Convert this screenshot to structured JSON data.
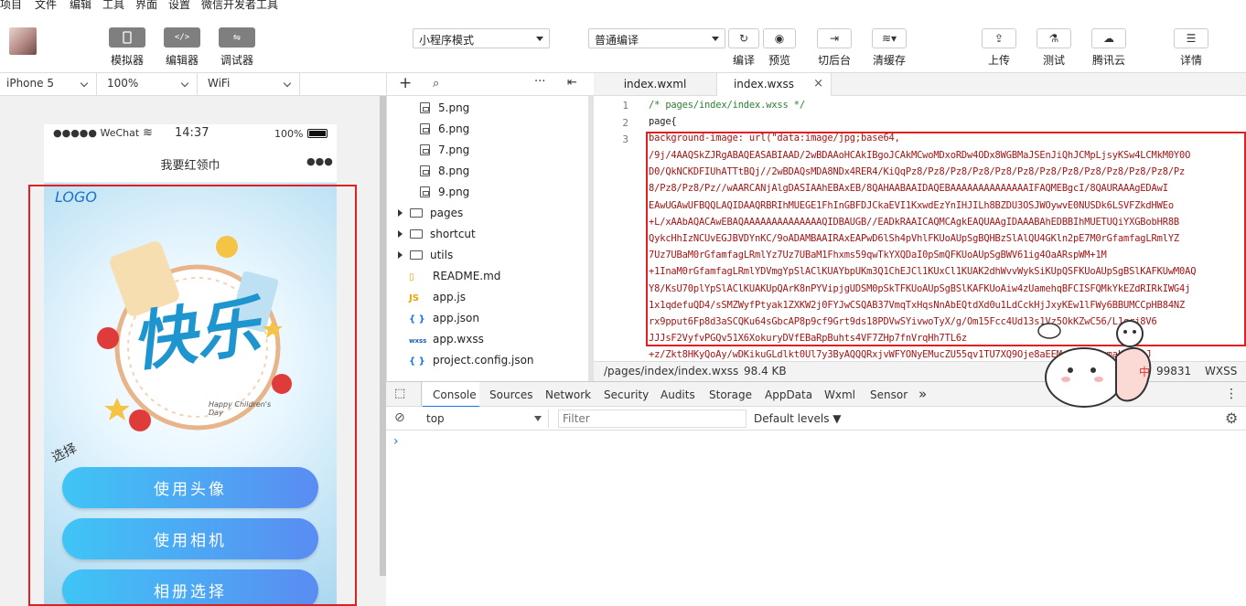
{
  "menubar": [
    "项目",
    "文件",
    "编辑",
    "工具",
    "界面",
    "设置",
    "微信开发者工具"
  ],
  "toolbar": {
    "simulator": "模拟器",
    "editor": "编辑器",
    "debugger": "调试器",
    "mode_select": "小程序模式",
    "compile_select": "普通编译",
    "compile": "编译",
    "preview": "预览",
    "background": "切后台",
    "clear_cache": "清缓存",
    "upload": "上传",
    "test": "测试",
    "tencent_cloud": "腾讯云",
    "details": "详情"
  },
  "device": {
    "model": "iPhone 5",
    "zoom": "100%",
    "network": "WiFi"
  },
  "phone": {
    "carrier": "●●●●● WeChat",
    "time": "14:37",
    "battery": "100%",
    "nav_title": "我要红领巾",
    "nav_more": "●●●",
    "logo": "LOGO",
    "poster_title": "快乐",
    "poster_sub": "Happy Children's Day",
    "side_text": "选择",
    "buttons": [
      "使用头像",
      "使用相机",
      "相册选择"
    ]
  },
  "tree": {
    "files": [
      {
        "name": "5.png",
        "type": "image",
        "indent": 1
      },
      {
        "name": "6.png",
        "type": "image",
        "indent": 1
      },
      {
        "name": "7.png",
        "type": "image",
        "indent": 1
      },
      {
        "name": "8.png",
        "type": "image",
        "indent": 1
      },
      {
        "name": "9.png",
        "type": "image",
        "indent": 1
      },
      {
        "name": "pages",
        "type": "folder",
        "indent": 0
      },
      {
        "name": "shortcut",
        "type": "folder",
        "indent": 0
      },
      {
        "name": "utils",
        "type": "folder",
        "indent": 0
      },
      {
        "name": "README.md",
        "type": "md",
        "indent": 0
      },
      {
        "name": "app.js",
        "type": "js",
        "indent": 0
      },
      {
        "name": "app.json",
        "type": "json",
        "indent": 0
      },
      {
        "name": "app.wxss",
        "type": "wxss",
        "indent": 0
      },
      {
        "name": "project.config.json",
        "type": "json",
        "indent": 0
      }
    ]
  },
  "tabs": [
    "index.wxml",
    "index.wxss"
  ],
  "code": {
    "line_numbers": [
      "1",
      "2",
      "3"
    ],
    "line1": "/* pages/index/index.wxss */",
    "line2": "page{",
    "line3": " background-image: url(\"data:image/jpg;base64,",
    "data": [
      "/9j/4AAQSkZJRgABAQEASABIAAD/2wBDAAoHCAkIBgoJCAkMCwoMDxoRDw4ODx8WGBMaJSEnJiQhJCMpLjsyKSw4LCMkM0Y0O",
      "D0/QkNCKDFIUhATTtBQj//2wBDAQsMDA8NDx4RER4/KiQqPz8/Pz8/Pz8/Pz8/Pz8/Pz8/Pz8/Pz8/Pz8/Pz8/Pz8/Pz8/Pz",
      "8/Pz8/Pz8/Pz//wAARCANjAlgDASIAAhEBAxEB/8QAHAABAAIDAQEBAAAAAAAAAAAAAAIFAQMEBgcI/8QAURAAAgEDAwI",
      "EAwUGAwUFBQQLAQIDAAQRBRIhMUEGE1FhInGBFDJCkaEVI1KxwdEzYnIHJILh8BZDU3OSJWOywvE0NUSDk6LSVFZkdHWEo",
      "+L/xAAbAQACAwEBAQAAAAAAAAAAAAAAQIDBAUGB//EADkRAAICAQMCAgkEAQUAAgIDAAABAhEDBBIhMUETUQiYXGBobHR8B",
      "QykcHhIzNCUvEGJBVDYnKC/9oADAMBAAIRAxEAPwD6lSh4pVhlFKUoAUpSgBQHBzSlAlQU4GKln2pE7M0rGfamfagLRmlYZ",
      "7Uz7UBaM0rGfamfagLRmlYz7Uz7UBaM1Fhxms59qwTkYXQDaI0pSmQFKUoAUpSgBWV61ig4OaARspWM+1M",
      "+1InaM0rGfamfagLRmlYDVmgYpSlAClKUAYbpUKm3Q1ChEJCl1KUxCl1KUAK2dhWvvWykSiKUpQSFKUoAUpSgBSlKAFKUwM0AQ",
      "Y8/KsU70plYpSlAClKUAKUpQArK8nPYVipjgUDSM0pSkTFKUoAUpSgBSlKAFKUoAiw4zUamehqBFCISFQMkYkEZdRIRkIWG4j",
      "1x1qdefuQD4/sSMZWyfPtyak1ZXKW2j0FYJwCSQAB37VmqTxHqsNnAbEQtdXd0u1LdCckHjJxyKEw1lFWy6BBUMCCpHB84NZ",
      "rx9pput6Fp8d3aSCQKu64sGbcAP8p9cf9Grt9ds18PDVwSYivwoTyX/g/Om15Fcc4Ud13s1Vz5OkKZwC56/L1qrj8V6",
      "JJJsF2VyfvPGQv51X6XokuryDVfEBaRpBuhts4VF7ZHp7fnVrqHh7TL6z",
      "+z/Zkt8HKyQoAy/wDKikuGLdlkt0Ul7y3ByAQQQRxjvWFYONyEMucZU55qv1TU7XQ9Oje8aEEMxBSg5rzmmaLrMdvJ"
    ],
    "status_path": "/pages/index/index.wxss",
    "status_size": "98.4 KB",
    "status_pos": "99831",
    "status_lang": "WXSS"
  },
  "devtools": {
    "tabs": [
      "Console",
      "Sources",
      "Network",
      "Security",
      "Audits",
      "Storage",
      "AppData",
      "Wxml",
      "Sensor"
    ],
    "more": "»",
    "context": "top",
    "filter_placeholder": "Filter",
    "levels": "Default levels ▼",
    "prompt": "›"
  },
  "sticker": {
    "label": "中"
  }
}
